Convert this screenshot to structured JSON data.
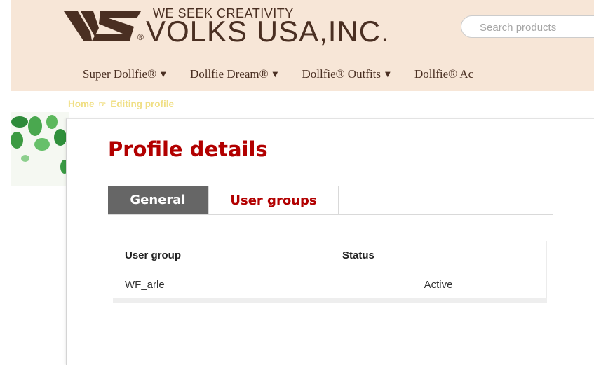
{
  "header": {
    "logo": {
      "tagline": "WE SEEK CREATIVITY",
      "brand": "VOLKS USA,INC.",
      "reg_mark": "®"
    },
    "search": {
      "placeholder": "Search products"
    },
    "nav": [
      {
        "label": "Super Dollfie®"
      },
      {
        "label": "Dollfie Dream®"
      },
      {
        "label": "Dollfie® Outfits"
      },
      {
        "label": "Dollfie® Ac"
      }
    ]
  },
  "breadcrumb": {
    "home": "Home",
    "current": "Editing profile"
  },
  "page": {
    "title": "Profile details",
    "tabs": [
      {
        "label": "General",
        "active": true
      },
      {
        "label": "User groups",
        "active": false
      }
    ],
    "table": {
      "headers": [
        "User group",
        "Status"
      ],
      "rows": [
        {
          "group": "WF_arle",
          "status": "Active"
        }
      ]
    }
  },
  "colors": {
    "header_bg": "#f7e6d7",
    "brand_brown": "#4a2f22",
    "title_red": "#b20000",
    "active_tab_bg": "#666666",
    "breadcrumb_yellow": "#f0df85"
  }
}
